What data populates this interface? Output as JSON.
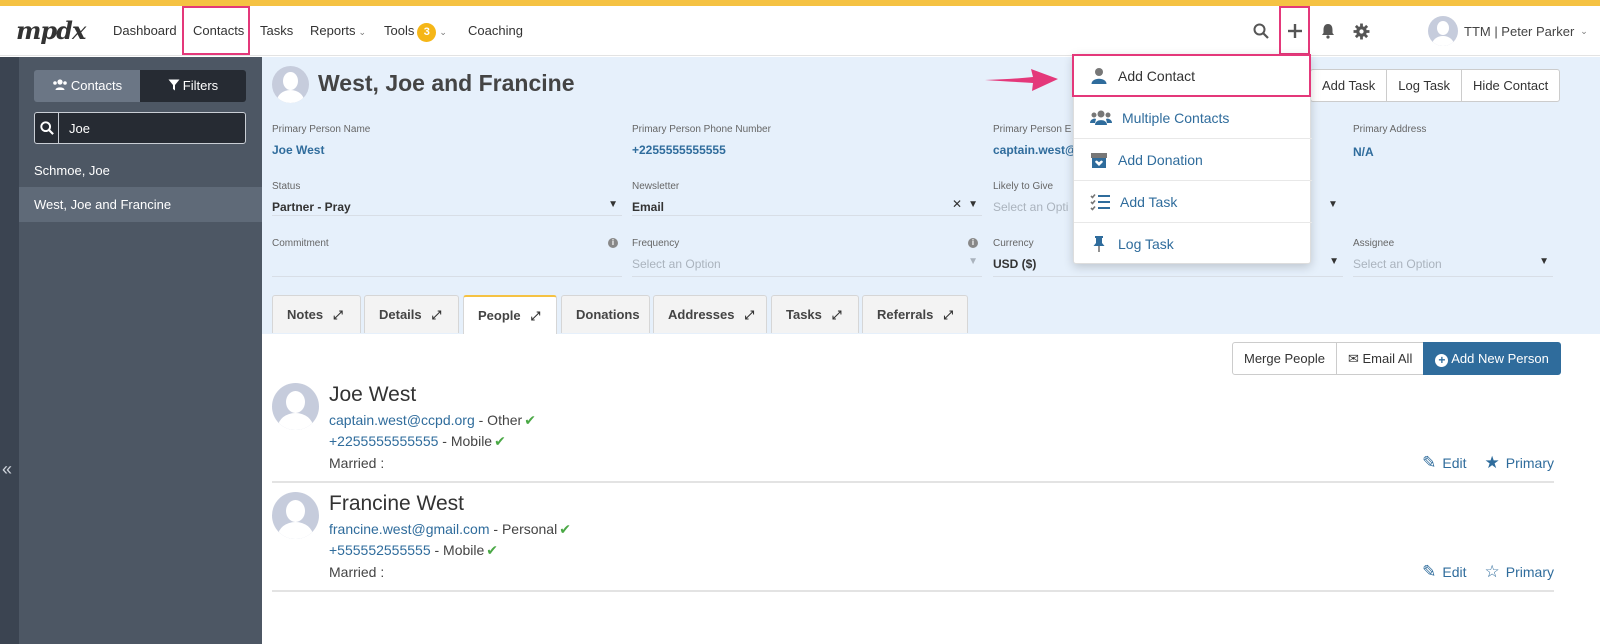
{
  "nav": {
    "logo": "mpdx",
    "items": [
      "Dashboard",
      "Contacts",
      "Tasks",
      "Reports",
      "Tools",
      "Coaching"
    ],
    "tools_badge": "3",
    "user": "TTM | Peter Parker"
  },
  "sidebar": {
    "contacts_label": "Contacts",
    "filters_label": "Filters",
    "search_value": "Joe",
    "results": [
      "Schmoe, Joe",
      "West, Joe and Francine"
    ]
  },
  "contact": {
    "name": "West, Joe and Francine",
    "actions": [
      "Add Task",
      "Log Task",
      "Hide Contact"
    ],
    "fields": {
      "primary_person_name": {
        "label": "Primary Person Name",
        "value": "Joe West"
      },
      "primary_phone": {
        "label": "Primary Person Phone Number",
        "value": "+2255555555555"
      },
      "primary_email": {
        "label": "Primary Person E",
        "value": "captain.west@"
      },
      "primary_address": {
        "label": "Primary Address",
        "value": "N/A"
      },
      "status": {
        "label": "Status",
        "value": "Partner - Pray"
      },
      "newsletter": {
        "label": "Newsletter",
        "value": "Email"
      },
      "likely_to_give": {
        "label": "Likely to Give",
        "value": "Select an Opti"
      },
      "commitment": {
        "label": "Commitment",
        "value": ""
      },
      "frequency": {
        "label": "Frequency",
        "value": "Select an Option"
      },
      "currency": {
        "label": "Currency",
        "value": "USD ($)"
      },
      "assignee": {
        "label": "Assignee",
        "value": "Select an Option"
      }
    }
  },
  "tabs": [
    "Notes",
    "Details",
    "People",
    "Donations",
    "Addresses",
    "Tasks",
    "Referrals"
  ],
  "people_toolbar": {
    "merge": "Merge People",
    "email_all": "Email All",
    "add_new": "Add New Person"
  },
  "people": [
    {
      "name": "Joe West",
      "email": "captain.west@ccpd.org",
      "email_type": "- Other",
      "phone": "+2255555555555",
      "phone_type": "- Mobile",
      "marital": "Married :",
      "edit": "Edit",
      "primary": "Primary"
    },
    {
      "name": "Francine West",
      "email": "francine.west@gmail.com",
      "email_type": "- Personal",
      "phone": "+555552555555",
      "phone_type": "- Mobile",
      "marital": "Married :",
      "edit": "Edit",
      "primary": "Primary"
    }
  ],
  "add_menu": [
    "Add Contact",
    "Multiple Contacts",
    "Add Donation",
    "Add Task",
    "Log Task"
  ],
  "colors": {
    "accent": "#2f6c9c",
    "highlight": "#e4387a",
    "top_stripe": "#f5c243",
    "check": "#4aa845"
  }
}
